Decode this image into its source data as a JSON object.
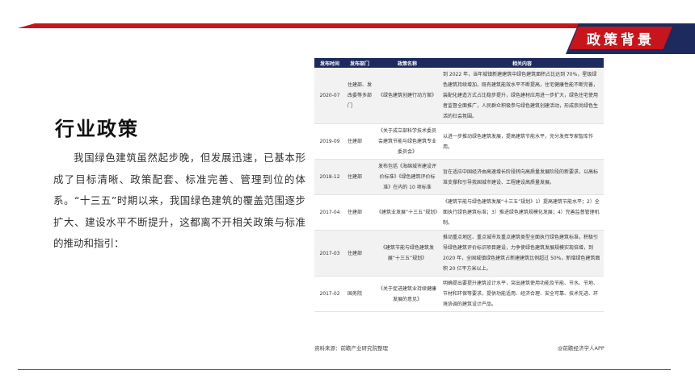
{
  "header": {
    "banner_label": "政策背景"
  },
  "main": {
    "title": "行业政策",
    "intro": "我国绿色建筑虽然起步晚，但发展迅速，已基本形成了目标清晰、政策配套、标准完善、管理到位的体系。“十三五”时期以来，我国绿色建筑的覆盖范围逐步扩大、建设水平不断提升，这都离不开相关政策与标准的推动和指引："
  },
  "table": {
    "headers": [
      "发布时间",
      "发布部门",
      "政策名称",
      "相关内容"
    ],
    "rows": [
      {
        "date": "2020-07",
        "dept": "住建部、发改委等多部门",
        "name": "《绿色建筑创建行动方案》",
        "content": "到 2022 年，当年城镇新建建筑中绿色建筑面积占比达到 70%，星级绿色建筑持续增加，既有建筑能效水平不断提高，住宅健康性能不断完善，装配化建造方式占比稳步提升，绿色建材应用进一步扩大，绿色住宅使用者监督全面推广，人民群众积极参与绿色建筑创建活动，形成崇尚绿色生活的社会氛围。"
      },
      {
        "date": "2019-09",
        "dept": "住建部",
        "name": "《关于成立部科学技术委员会建筑节能与绿色建筑专业委员会》",
        "content": "以进一步推动绿色建筑发展，提高建筑节能水平，充分发挥专家智库作用。"
      },
      {
        "date": "2018-12",
        "dept": "住建部",
        "name": "发布包括《海绵城市建设评价标准》《绿色建筑评价标准》在内的 10 项标准",
        "content": "旨在适应中国经济由高速增长阶段转向高质量发展阶段的新要求，以高标准支撑和引导我国城市建设、工程建设高质量发展。"
      },
      {
        "date": "2017-04",
        "dept": "住建部",
        "name": "《建筑业发展“十三五”规划》",
        "content": "《建筑节能与绿色建筑发展“十三五”规划》1）提高建筑节能水平；2）全面执行绿色建筑标准；3）推进绿色建筑规模化发展；4）完善监督管理机制。"
      },
      {
        "date": "2017-03",
        "dept": "住建部",
        "name": "《建筑节能与绿色建筑发展“十三五”规划》",
        "content": "推动重点地区、重点城市及重点建筑类型全面执行绿色建筑标准，积极引导绿色建筑评价标识项目建设，力争使绿色建筑发展规模实现倍增，到 2020 年，全国城镇绿色建筑占新建建筑比例超过 50%，新增绿色建筑面积 20 亿平方米以上。"
      },
      {
        "date": "2017-02",
        "dept": "国务院",
        "name": "《关于促进建筑业持续健康发展的意见》",
        "content": "明确提出要提升建筑设计水平，突出建筑使用功能及节能、节水、节地、节材和环保等要求，提供功能适用、经济合理、安全可靠、技术先进、环境协调的建筑设计产品。"
      }
    ]
  },
  "footer": {
    "source": "资料来源：前瞻产业研究院整理",
    "credit": "@前瞻经济学人APP"
  }
}
